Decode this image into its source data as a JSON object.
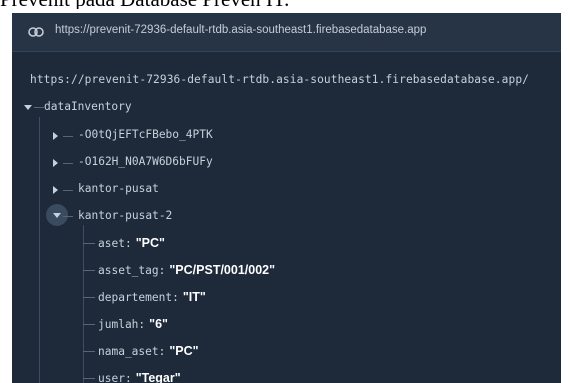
{
  "caption": "Prevenit pada Database Preven IT.",
  "url_bar": {
    "url": "https://prevenit-72936-default-rtdb.asia-southeast1.firebasedatabase.app"
  },
  "root_url": "https://prevenit-72936-default-rtdb.asia-southeast1.firebasedatabase.app/",
  "tree": {
    "root_key": "dataInventory",
    "children": [
      {
        "key": "-O0tQjEFTcFBebo_4PTK",
        "expanded": false
      },
      {
        "key": "-O162H_N0A7W6D6bFUFy",
        "expanded": false
      },
      {
        "key": "kantor-pusat",
        "expanded": false
      },
      {
        "key": "kantor-pusat-2",
        "expanded": true,
        "fields": [
          {
            "key": "aset",
            "value": "\"PC\""
          },
          {
            "key": "asset_tag",
            "value": "\"PC/PST/001/002\""
          },
          {
            "key": "departement",
            "value": "\"IT\""
          },
          {
            "key": "jumlah",
            "value": "\"6\""
          },
          {
            "key": "nama_aset",
            "value": "\"PC\""
          },
          {
            "key": "user",
            "value": "\"Tegar\""
          }
        ]
      }
    ]
  },
  "colors": {
    "panel_bg": "#1e2a3a",
    "urlbar_bg": "#273446",
    "text": "#c8d0da",
    "value": "#ffffff"
  },
  "icons": {
    "url": "link-icon",
    "collapsed": "triangle-right-icon",
    "expanded": "triangle-down-icon"
  }
}
